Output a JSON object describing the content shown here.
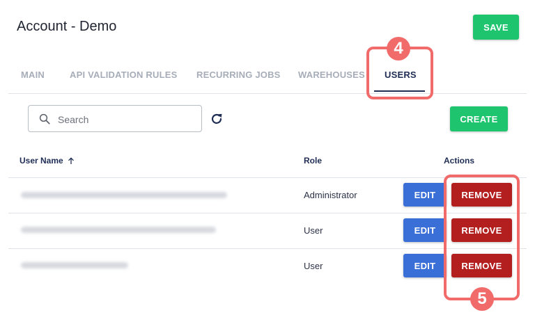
{
  "page": {
    "title": "Account - Demo"
  },
  "toolbar": {
    "save_label": "SAVE"
  },
  "tabs": [
    {
      "label": "MAIN",
      "active": false
    },
    {
      "label": "API VALIDATION RULES",
      "active": false
    },
    {
      "label": "RECURRING JOBS",
      "active": false
    },
    {
      "label": "WAREHOUSES",
      "active": false
    },
    {
      "label": "USERS",
      "active": true
    }
  ],
  "users": {
    "search_placeholder": "Search",
    "create_label": "CREATE",
    "columns": {
      "user_name": "User Name",
      "role": "Role",
      "actions": "Actions"
    },
    "sort_icon": "arrow-up-icon",
    "rows": [
      {
        "role": "Administrator",
        "edit_label": "EDIT",
        "remove_label": "REMOVE"
      },
      {
        "role": "User",
        "edit_label": "EDIT",
        "remove_label": "REMOVE"
      },
      {
        "role": "User",
        "edit_label": "EDIT",
        "remove_label": "REMOVE"
      }
    ]
  },
  "annotations": {
    "tab_step": "4",
    "remove_step": "5"
  },
  "colors": {
    "accent_green": "#1ec46e",
    "edit_blue": "#3b6fd8",
    "remove_red": "#b31f1f",
    "annotation": "#f26b6b",
    "tab_active": "#1f2d55"
  }
}
